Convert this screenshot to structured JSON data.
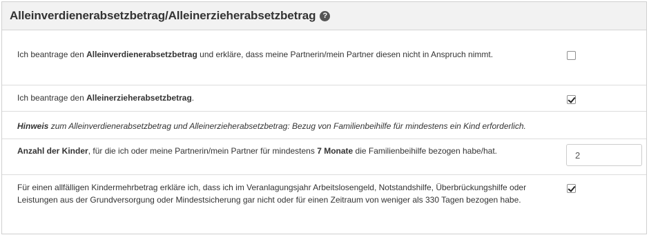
{
  "header": {
    "title": "Alleinverdienerabsetzbetrag/Alleinerzieherabsetzbetrag",
    "help_icon": "?"
  },
  "rows": [
    {
      "text_before": "Ich beantrage den ",
      "bold": "Alleinverdienerabsetzbetrag",
      "text_after": " und erkläre, dass meine Partnerin/mein Partner diesen nicht in Anspruch nimmt.",
      "checked": false
    },
    {
      "text_before": "Ich beantrage den ",
      "bold": "Alleinerzieherabsetzbetrag",
      "text_after": ".",
      "checked": true
    },
    {
      "bold": "Hinweis",
      "text_after": " zum Alleinverdienerabsetzbetrag und Alleinerzieherabsetzbetrag: Bezug von Familienbeihilfe für mindestens ein Kind erforderlich."
    },
    {
      "bold": "Anzahl der Kinder",
      "text_mid": ", für die ich oder meine Partnerin/mein Partner für mindestens ",
      "bold2": "7 Monate",
      "text_after": " die Familienbeihilfe bezogen habe/hat.",
      "input_value": "2"
    },
    {
      "text": "Für einen allfälligen Kindermehrbetrag erkläre ich, dass ich im Veranlagungsjahr Arbeitslosengeld, Notstandshilfe, Überbrückungshilfe oder Leistungen aus der Grundversorgung oder Mindestsicherung gar nicht oder für einen Zeitraum von weniger als 330 Tagen bezogen habe.",
      "checked": true
    }
  ]
}
